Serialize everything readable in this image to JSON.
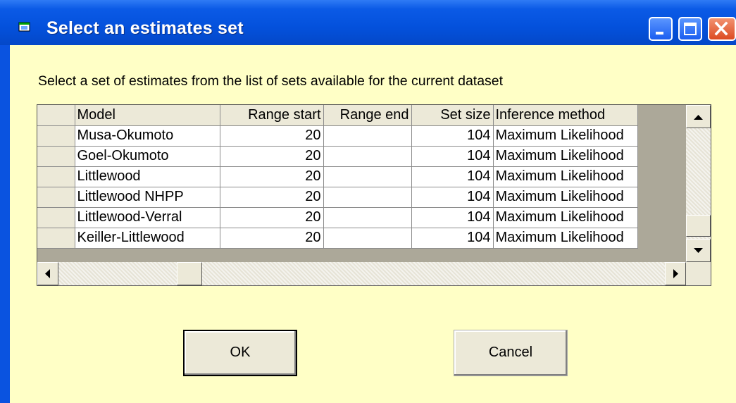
{
  "window": {
    "title": "Select an estimates set"
  },
  "prompt": "Select a set of estimates from the list of sets available for the current dataset",
  "table": {
    "columns": [
      "Model",
      "Range start",
      "Range end",
      "Set size",
      "Inference method"
    ],
    "rows": [
      [
        "Musa-Okumoto",
        "20",
        "",
        "104",
        "Maximum Likelihood"
      ],
      [
        "Goel-Okumoto",
        "20",
        "",
        "104",
        "Maximum Likelihood"
      ],
      [
        "Littlewood",
        "20",
        "",
        "104",
        "Maximum Likelihood"
      ],
      [
        "Littlewood NHPP",
        "20",
        "",
        "104",
        "Maximum Likelihood"
      ],
      [
        "Littlewood-Verral",
        "20",
        "",
        "104",
        "Maximum Likelihood"
      ],
      [
        "Keiller-Littlewood",
        "20",
        "",
        "104",
        "Maximum Likelihood"
      ]
    ]
  },
  "buttons": {
    "ok": "OK",
    "cancel": "Cancel"
  },
  "icons": {
    "app": "window-app-icon",
    "minimize": "minimize-icon",
    "maximize": "maximize-icon",
    "close": "close-icon"
  },
  "colors": {
    "titlebar": "#0451dc",
    "client_background": "#ffffc6",
    "button_face": "#ece9d8",
    "close": "#dc4b22"
  }
}
